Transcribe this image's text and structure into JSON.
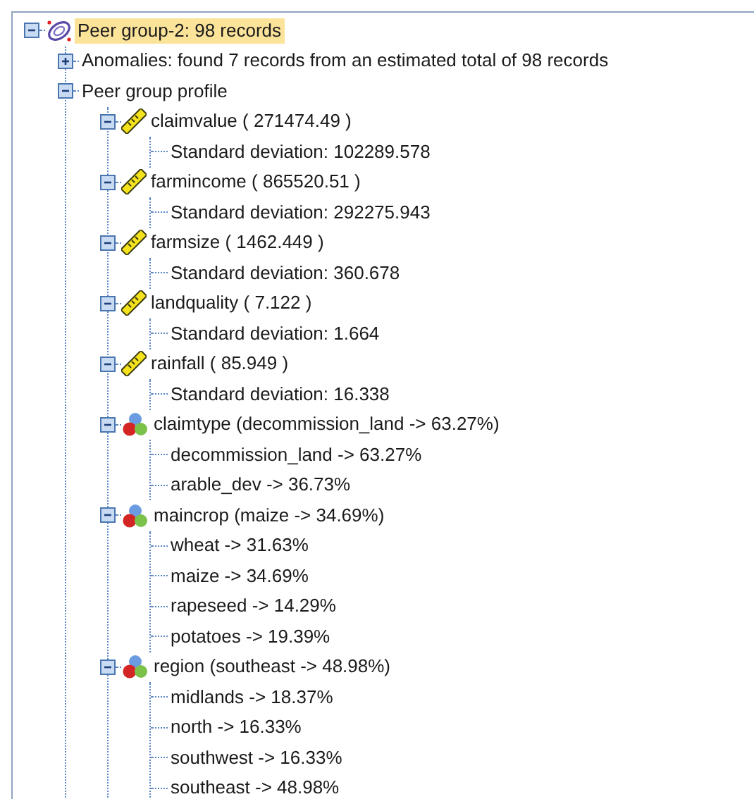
{
  "tree": [
    {
      "label": "Peer group-2: 98 records",
      "kind": "group",
      "expanded": true,
      "selected": true,
      "children": [
        {
          "label": "Anomalies: found 7 records from an estimated total of 98 records",
          "kind": "folder",
          "expanded": false,
          "selected": false
        },
        {
          "label": "Peer group profile",
          "kind": "folder",
          "expanded": true,
          "selected": false,
          "children": [
            {
              "label": "claimvalue ( 271474.49 )",
              "kind": "numeric",
              "expanded": true,
              "selected": false,
              "children": [
                {
                  "label": "Standard deviation: 102289.578",
                  "kind": "leaf",
                  "selected": false
                }
              ]
            },
            {
              "label": "farmincome ( 865520.51 )",
              "kind": "numeric",
              "expanded": true,
              "selected": false,
              "children": [
                {
                  "label": "Standard deviation: 292275.943",
                  "kind": "leaf",
                  "selected": false
                }
              ]
            },
            {
              "label": "farmsize ( 1462.449 )",
              "kind": "numeric",
              "expanded": true,
              "selected": false,
              "children": [
                {
                  "label": "Standard deviation: 360.678",
                  "kind": "leaf",
                  "selected": false
                }
              ]
            },
            {
              "label": "landquality ( 7.122 )",
              "kind": "numeric",
              "expanded": true,
              "selected": false,
              "children": [
                {
                  "label": "Standard deviation: 1.664",
                  "kind": "leaf",
                  "selected": false
                }
              ]
            },
            {
              "label": "rainfall ( 85.949 )",
              "kind": "numeric",
              "expanded": true,
              "selected": false,
              "children": [
                {
                  "label": "Standard deviation: 16.338",
                  "kind": "leaf",
                  "selected": false
                }
              ]
            },
            {
              "label": "claimtype (decommission_land -> 63.27%)",
              "kind": "nominal",
              "expanded": true,
              "selected": false,
              "children": [
                {
                  "label": "decommission_land -> 63.27%",
                  "kind": "leaf",
                  "selected": false
                },
                {
                  "label": "arable_dev -> 36.73%",
                  "kind": "leaf",
                  "selected": false
                }
              ]
            },
            {
              "label": "maincrop (maize -> 34.69%)",
              "kind": "nominal",
              "expanded": true,
              "selected": false,
              "children": [
                {
                  "label": "wheat -> 31.63%",
                  "kind": "leaf",
                  "selected": false
                },
                {
                  "label": "maize -> 34.69%",
                  "kind": "leaf",
                  "selected": false
                },
                {
                  "label": "rapeseed -> 14.29%",
                  "kind": "leaf",
                  "selected": false
                },
                {
                  "label": "potatoes -> 19.39%",
                  "kind": "leaf",
                  "selected": false
                }
              ]
            },
            {
              "label": "region (southeast -> 48.98%)",
              "kind": "nominal",
              "expanded": true,
              "selected": false,
              "children": [
                {
                  "label": "midlands -> 18.37%",
                  "kind": "leaf",
                  "selected": false
                },
                {
                  "label": "north -> 16.33%",
                  "kind": "leaf",
                  "selected": false
                },
                {
                  "label": "southwest -> 16.33%",
                  "kind": "leaf",
                  "selected": false
                },
                {
                  "label": "southeast -> 48.98%",
                  "kind": "leaf",
                  "selected": false
                }
              ]
            }
          ]
        }
      ]
    }
  ]
}
